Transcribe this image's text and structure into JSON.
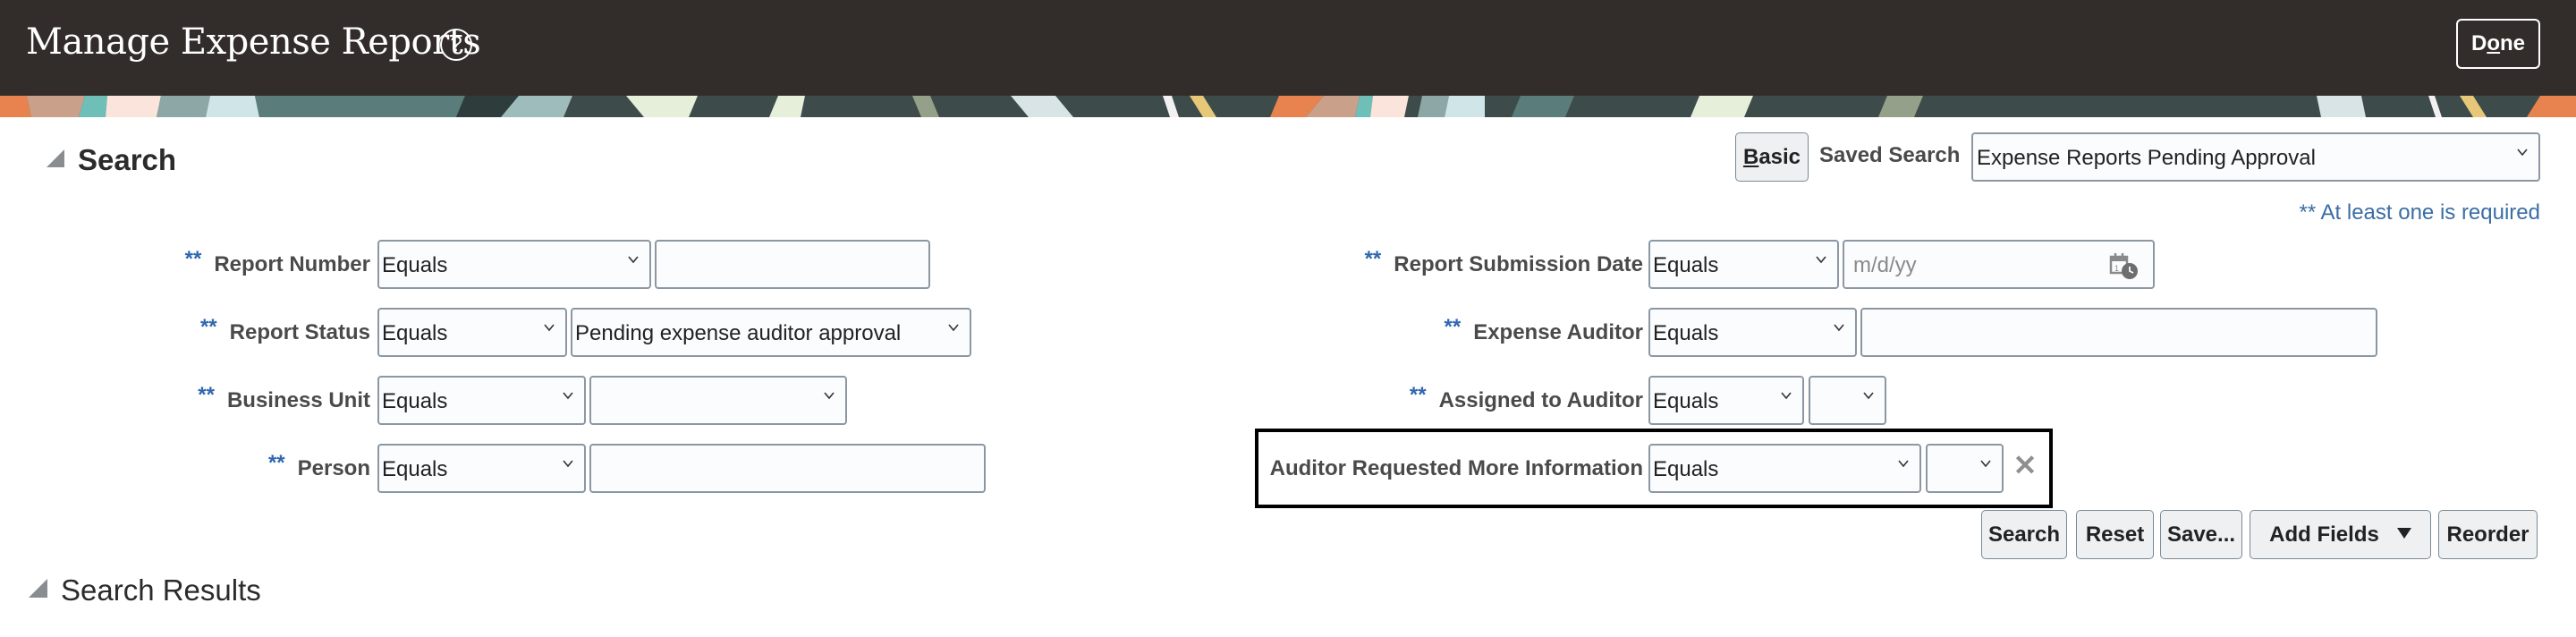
{
  "header": {
    "title": "Manage Expense Reports",
    "help_icon": "question-circle-icon",
    "done_label_pre": "D",
    "done_label_u": "o",
    "done_label_post": "ne"
  },
  "search_section": {
    "heading": "Search",
    "basic_label_u": "B",
    "basic_label_post": "asic",
    "saved_search_label": "Saved Search",
    "saved_search_value": "Expense Reports Pending Approval",
    "required_note": "** At least one is required",
    "required_marker": "**",
    "left_fields": [
      {
        "label": "Report Number",
        "operator": "Equals",
        "value": ""
      },
      {
        "label": "Report Status",
        "operator": "Equals",
        "value": "Pending expense auditor approval"
      },
      {
        "label": "Business Unit",
        "operator": "Equals",
        "value": ""
      },
      {
        "label": "Person",
        "operator": "Equals",
        "value": ""
      }
    ],
    "right_fields": [
      {
        "label": "Report Submission Date",
        "operator": "Equals",
        "value": "",
        "placeholder": "m/d/yy"
      },
      {
        "label": "Expense Auditor",
        "operator": "Equals",
        "value": ""
      },
      {
        "label": "Assigned to Auditor",
        "operator": "Equals",
        "value": ""
      },
      {
        "label": "Auditor Requested More Information",
        "operator": "Equals",
        "value": ""
      }
    ],
    "remove_icon": "✕",
    "buttons": {
      "search": "Search",
      "reset": "Reset",
      "save": "Save...",
      "add_fields": "Add Fields",
      "reorder": "Reorder"
    }
  },
  "results_section": {
    "heading": "Search Results"
  },
  "colors": {
    "header_bg": "#322d2a",
    "required_blue": "#2f67b0",
    "note_blue": "#3a6ea5",
    "input_border": "#8b98a3"
  }
}
